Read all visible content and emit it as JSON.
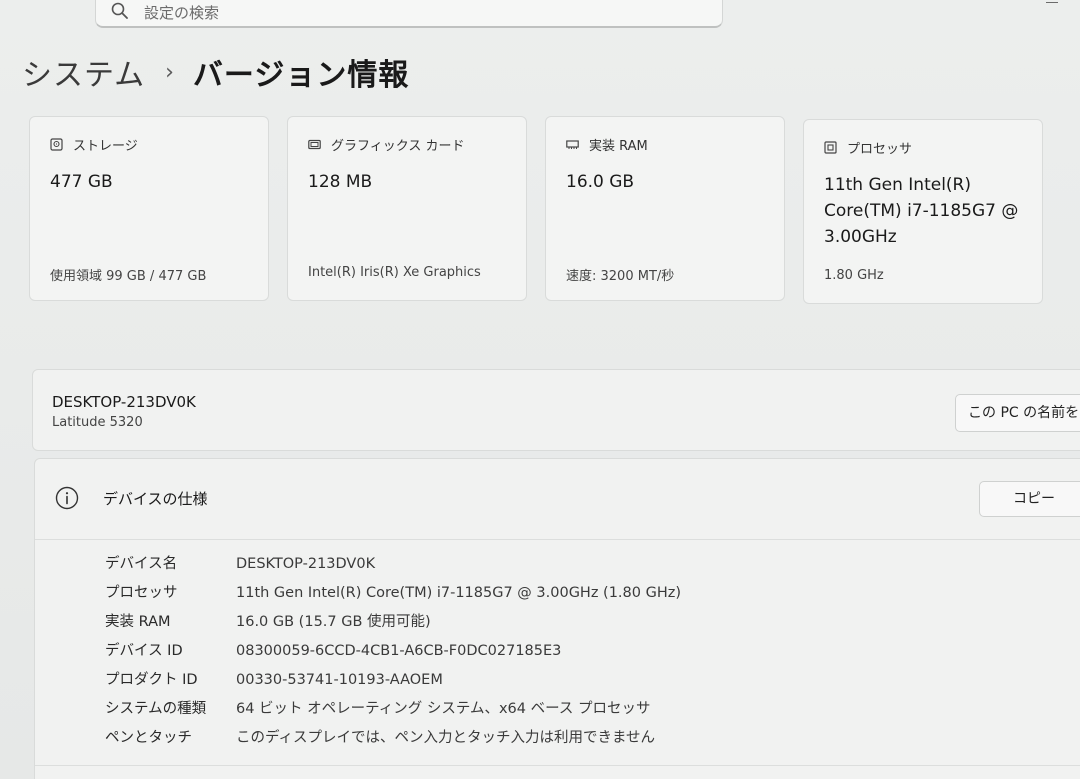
{
  "search": {
    "placeholder": "設定の検索"
  },
  "breadcrumb": {
    "parent": "システム",
    "separator": "›",
    "current": "バージョン情報"
  },
  "cards": [
    {
      "icon": "storage-icon",
      "label": "ストレージ",
      "value": "477 GB",
      "sub": "使用領域 99 GB / 477 GB"
    },
    {
      "icon": "graphics-card-icon",
      "label": "グラフィックス カード",
      "value": "128 MB",
      "sub": "Intel(R) Iris(R) Xe Graphics"
    },
    {
      "icon": "ram-icon",
      "label": "実装 RAM",
      "value": "16.0 GB",
      "sub": "速度: 3200 MT/秒"
    },
    {
      "icon": "processor-icon",
      "label": "プロセッサ",
      "value": "11th Gen Intel(R) Core(TM) i7-1185G7 @ 3.00GHz",
      "sub": "1.80 GHz"
    }
  ],
  "device": {
    "name": "DESKTOP-213DV0K",
    "model": "Latitude 5320",
    "rename_label": "この PC の名前を"
  },
  "specs": {
    "title": "デバイスの仕様",
    "copy_label": "コピー",
    "rows": [
      {
        "label": "デバイス名",
        "value": "DESKTOP-213DV0K"
      },
      {
        "label": "プロセッサ",
        "value": "11th Gen Intel(R) Core(TM) i7-1185G7 @ 3.00GHz (1.80 GHz)"
      },
      {
        "label": "実装 RAM",
        "value": "16.0 GB (15.7 GB 使用可能)"
      },
      {
        "label": "デバイス ID",
        "value": "08300059-6CCD-4CB1-A6CB-F0DC027185E3"
      },
      {
        "label": "プロダクト ID",
        "value": "00330-53741-10193-AAOEM"
      },
      {
        "label": "システムの種類",
        "value": "64 ビット オペレーティング システム、x64 ベース プロセッサ"
      },
      {
        "label": "ペンとタッチ",
        "value": "このディスプレイでは、ペン入力とタッチ入力は利用できません"
      }
    ]
  }
}
